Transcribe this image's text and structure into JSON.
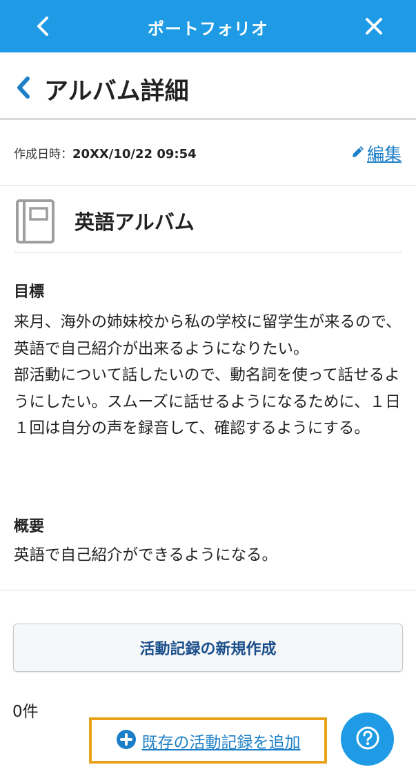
{
  "topbar": {
    "title": "ポートフォリオ",
    "back_icon": "chevron-left-icon",
    "close_icon": "close-icon"
  },
  "header": {
    "title": "アルバム詳細",
    "back_icon": "chevron-left-icon"
  },
  "meta": {
    "created_label": "作成日時：",
    "created_value": "20XX/10/22 09:54",
    "edit_label": "編集",
    "edit_icon": "pencil-icon"
  },
  "album": {
    "name": "英語アルバム",
    "icon": "book-icon"
  },
  "goal": {
    "title": "目標",
    "body": "来月、海外の姉妹校から私の学校に留学生が来るので、英語で自己紹介が出来るようになりたい。\n部活動について話したいので、動名詞を使って話せるようにしたい。スムーズに話せるようになるために、１日１回は自分の声を録音して、確認するようにする。"
  },
  "summary": {
    "title": "概要",
    "body": "英語で自己紹介ができるようになる。"
  },
  "actions": {
    "create_label": "活動記録の新規作成",
    "count_label": "0件",
    "add_existing_label": "既存の活動記録を追加",
    "add_icon": "plus-circle-icon",
    "help_icon": "question-circle-icon"
  },
  "colors": {
    "primary": "#1e9be4",
    "link": "#1b7fc7",
    "highlight": "#e8a21a",
    "button_text": "#1b4f8c"
  }
}
